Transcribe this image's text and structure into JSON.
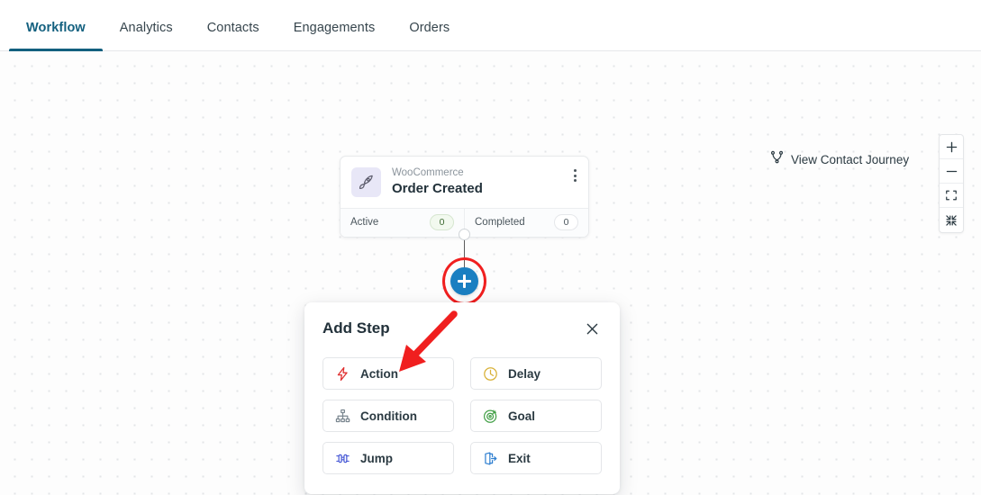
{
  "tabs": [
    {
      "label": "Workflow",
      "active": true
    },
    {
      "label": "Analytics",
      "active": false
    },
    {
      "label": "Contacts",
      "active": false
    },
    {
      "label": "Engagements",
      "active": false
    },
    {
      "label": "Orders",
      "active": false
    }
  ],
  "canvas": {
    "journey": {
      "label": "View Contact Journey",
      "icon": "branch-icon"
    },
    "zoom_controls": [
      {
        "name": "zoom-in",
        "glyph": "+"
      },
      {
        "name": "zoom-out",
        "glyph": "−"
      },
      {
        "name": "fit-view",
        "glyph": "fit-screen-icon"
      },
      {
        "name": "collapse-view",
        "glyph": "shrink-icon"
      }
    ]
  },
  "node": {
    "icon": "rocket-icon",
    "source": "WooCommerce",
    "title": "Order Created",
    "menu_icon": "kebab-menu-icon",
    "stats": [
      {
        "label": "Active",
        "value": "0",
        "tone": "green"
      },
      {
        "label": "Completed",
        "value": "0",
        "tone": "neutral"
      }
    ]
  },
  "add_step_panel": {
    "title": "Add Step",
    "close_icon": "close-icon",
    "options": [
      {
        "label": "Action",
        "icon": "lightning-bolt-icon",
        "color": "#e03131"
      },
      {
        "label": "Delay",
        "icon": "clock-icon",
        "color": "#d9b23a"
      },
      {
        "label": "Condition",
        "icon": "hierarchy-icon",
        "color": "#7b8790"
      },
      {
        "label": "Goal",
        "icon": "target-icon",
        "color": "#43a047"
      },
      {
        "label": "Jump",
        "icon": "jump-icon",
        "color": "#4a5bd6"
      },
      {
        "label": "Exit",
        "icon": "exit-door-icon",
        "color": "#2f7fd0"
      }
    ]
  },
  "annotations": {
    "arrow_color": "#f01f1f",
    "ring_color": "#f01f1f",
    "arrow_target": "Action",
    "ring_target": "add-step-plus-button"
  },
  "theme": {
    "accent": "#13607f",
    "plus_button": "#1a7fc1",
    "page_background": "#fdfdfd"
  }
}
